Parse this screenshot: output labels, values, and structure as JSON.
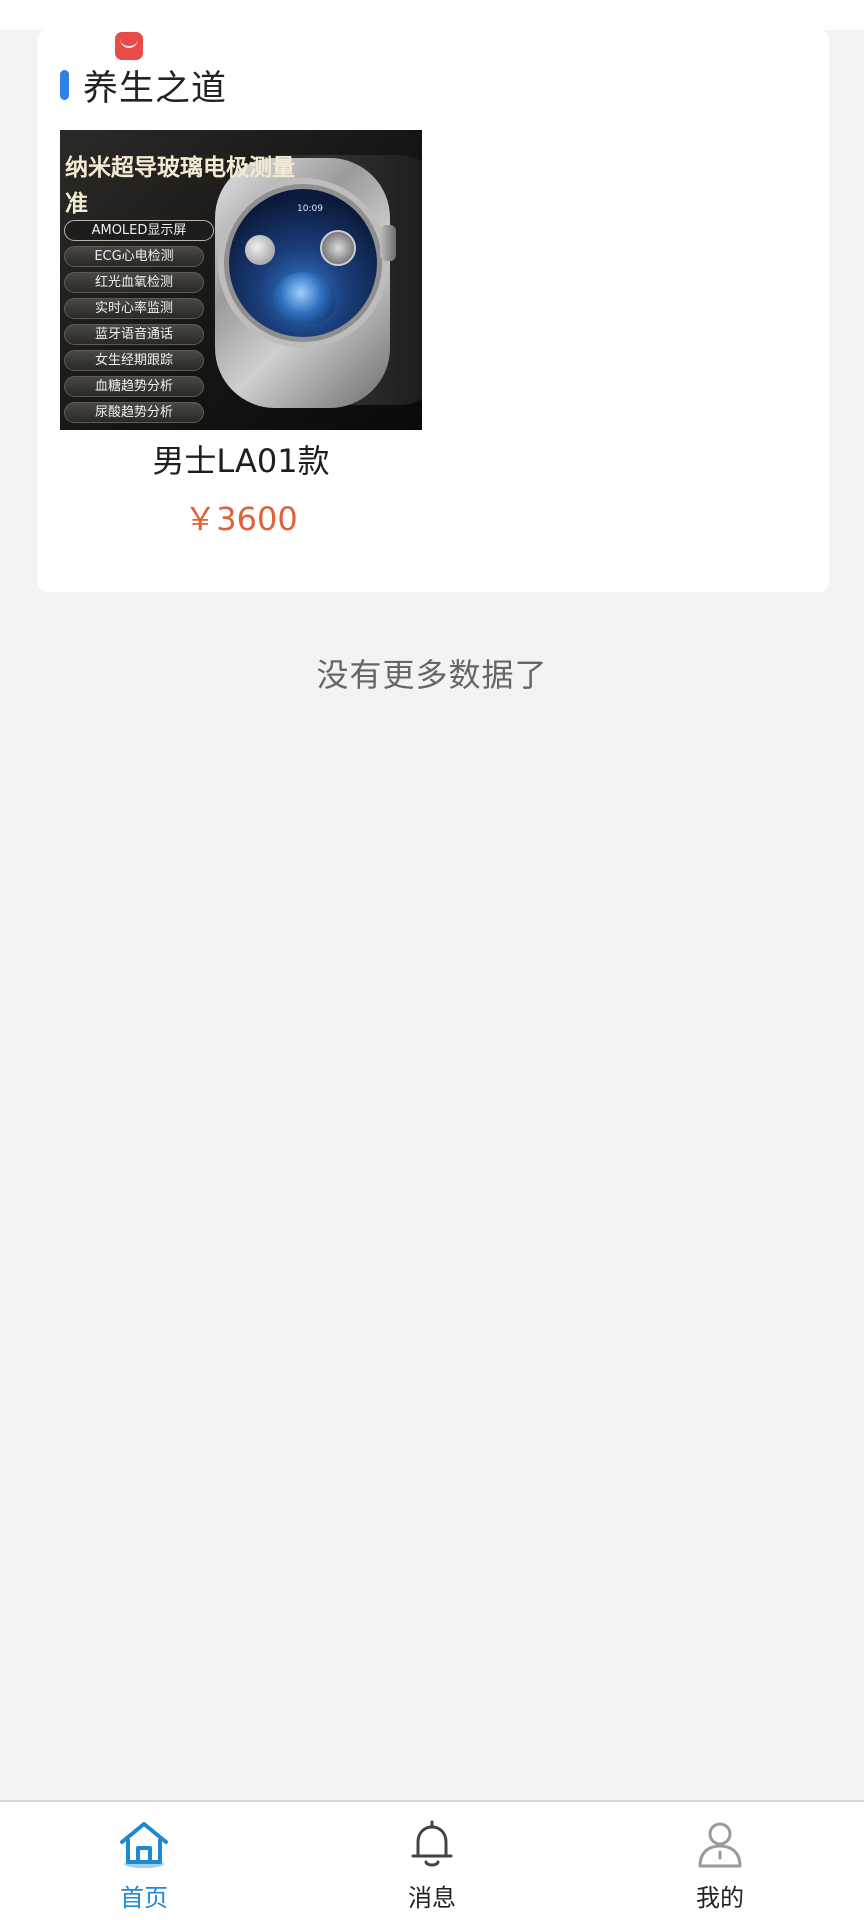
{
  "section": {
    "title": "养生之道"
  },
  "product": {
    "name": "男士LA01款",
    "price": "￥3600",
    "image": {
      "headline": "纳米超导玻璃电极测量准",
      "features": [
        "AMOLED显示屏",
        "ECG心电检测",
        "红光血氧检测",
        "实时心率监测",
        "蓝牙语音通话",
        "女生经期跟踪",
        "血糖趋势分析",
        "尿酸趋势分析"
      ],
      "watch_time": "10:09"
    }
  },
  "list_end_text": "没有更多数据了",
  "bottom_nav": {
    "items": [
      {
        "label": "首页",
        "icon": "home-icon",
        "active": true
      },
      {
        "label": "消息",
        "icon": "bell-icon",
        "active": false
      },
      {
        "label": "我的",
        "icon": "person-icon",
        "active": false
      }
    ]
  },
  "colors": {
    "accent_blue": "#2f7fe8",
    "nav_active": "#1f88d3",
    "price": "#e0613a",
    "app_badge": "#e94a4a"
  }
}
